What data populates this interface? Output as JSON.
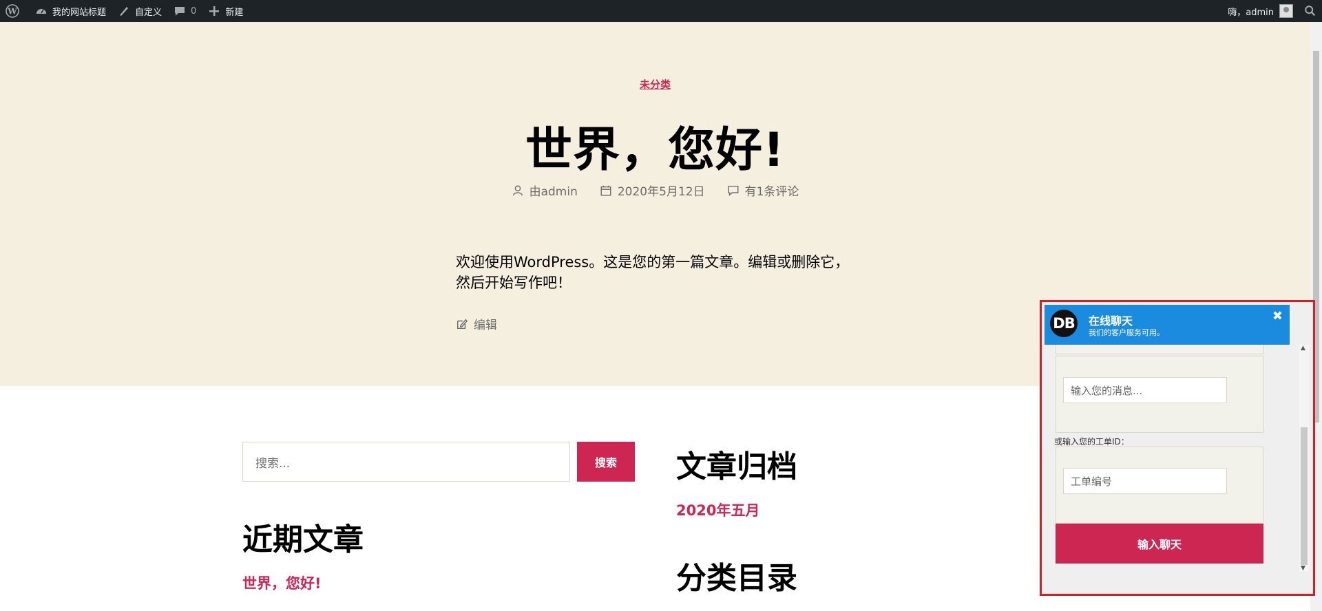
{
  "adminbar": {
    "site_name": "我的网站标题",
    "customize": "自定义",
    "comments_count": "0",
    "new": "新建",
    "greeting": "嗨，admin"
  },
  "post": {
    "category": "未分类",
    "title": "世界，您好!",
    "author": "由admin",
    "date": "2020年5月12日",
    "comments": "有1条评论",
    "content_line1": "欢迎使用WordPress。这是您的第一篇文章。编辑或删除它，",
    "content_line2": "然后开始写作吧！",
    "edit": "编辑"
  },
  "widgets": {
    "search_placeholder": "搜索...",
    "search_button": "搜索",
    "recent_posts_title": "近期文章",
    "recent_post_1": "世界，您好!",
    "archives_title": "文章归档",
    "archive_1": "2020年五月",
    "categories_title": "分类目录"
  },
  "chat": {
    "logo": "DB",
    "title": "在线聊天",
    "subtitle": "我们的客户服务可用。",
    "message_placeholder": "输入您的消息...",
    "ticket_label": "或输入您的工单ID：",
    "ticket_placeholder": "工单编号",
    "submit": "输入聊天"
  },
  "colors": {
    "accent": "#cd2653",
    "hero_bg": "#f5efe0",
    "adminbar_bg": "#1d2327",
    "chat_header": "#1b8be0",
    "chat_border": "#d21f27"
  }
}
